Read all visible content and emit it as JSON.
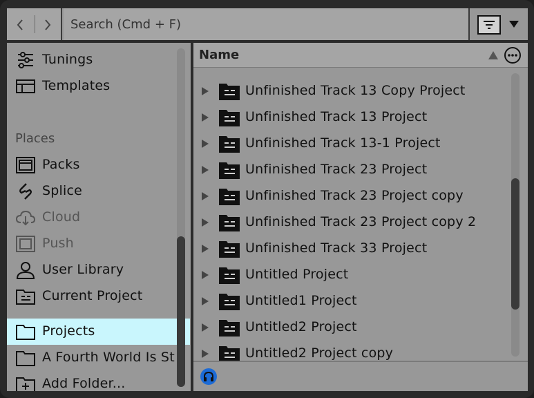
{
  "nav": {
    "back_icon": "chevron-left-icon",
    "forward_icon": "chevron-right-icon"
  },
  "search": {
    "placeholder": "Search (Cmd + F)",
    "value": ""
  },
  "toolbar": {
    "filter_icon": "filter-icon",
    "dropdown_icon": "triangle-down-icon"
  },
  "sidebar": {
    "top_items": [
      {
        "label": "Tunings",
        "icon": "tunings-icon"
      },
      {
        "label": "Templates",
        "icon": "templates-icon"
      }
    ],
    "places_header": "Places",
    "places": [
      {
        "label": "Packs",
        "icon": "packs-icon"
      },
      {
        "label": "Splice",
        "icon": "splice-icon"
      },
      {
        "label": "Cloud",
        "icon": "cloud-icon",
        "dimmed": true
      },
      {
        "label": "Push",
        "icon": "push-icon",
        "dimmed": true
      },
      {
        "label": "User Library",
        "icon": "user-icon"
      },
      {
        "label": "Current Project",
        "icon": "project-folder-icon"
      },
      {
        "label": "Projects",
        "icon": "folder-icon",
        "selected": true
      },
      {
        "label": "A Fourth World Is St",
        "icon": "folder-icon"
      },
      {
        "label": "Add Folder...",
        "icon": "add-folder-icon"
      }
    ]
  },
  "list": {
    "column_name": "Name",
    "sort_icon": "sort-ascending-icon",
    "more_icon": "more-options-icon",
    "rows": [
      "Unfinished Track 13 Copy Project",
      "Unfinished Track 13 Project",
      "Unfinished Track 13-1 Project",
      "Unfinished Track 23 Project",
      "Unfinished Track 23 Project copy",
      "Unfinished Track 23 Project copy 2",
      "Unfinished Track 33 Project",
      "Untitled Project",
      "Untitled1 Project",
      "Untitled2 Project",
      "Untitled2 Project copy"
    ]
  },
  "footer": {
    "hotswap_icon": "headphones-preview-icon"
  },
  "colors": {
    "panel": "#989898",
    "header": "#a5a5a5",
    "selected": "#c9f6fd",
    "border": "#2a2a2a",
    "preview_accent": "#1c6bd6"
  }
}
